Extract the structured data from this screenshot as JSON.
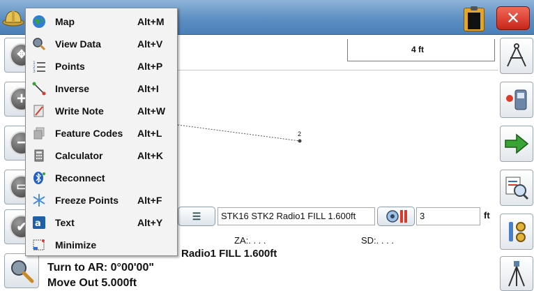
{
  "scale": {
    "label": "4 ft"
  },
  "point": {
    "label": "2"
  },
  "menu": {
    "items": [
      {
        "label": "Map",
        "accel": "Alt+M",
        "icon": "globe-icon"
      },
      {
        "label": "View Data",
        "accel": "Alt+V",
        "icon": "magnifier-icon"
      },
      {
        "label": "Points",
        "accel": "Alt+P",
        "icon": "numbered-list-icon"
      },
      {
        "label": "Inverse",
        "accel": "Alt+I",
        "icon": "line-segment-icon"
      },
      {
        "label": "Write Note",
        "accel": "Alt+W",
        "icon": "notepad-icon"
      },
      {
        "label": "Feature Codes",
        "accel": "Alt+L",
        "icon": "layers-icon"
      },
      {
        "label": "Calculator",
        "accel": "Alt+K",
        "icon": "calculator-icon"
      },
      {
        "label": "Reconnect",
        "accel": "",
        "icon": "bluetooth-icon"
      },
      {
        "label": "Freeze Points",
        "accel": "Alt+F",
        "icon": "snowflake-icon"
      },
      {
        "label": "Text",
        "accel": "Alt+Y",
        "icon": "text-icon"
      },
      {
        "label": "Minimize",
        "accel": "",
        "icon": "minimize-icon"
      }
    ]
  },
  "shot": {
    "description": "STK16 STK2 Radio1 FILL 1.600ft",
    "height": "3",
    "unit": "ft",
    "za_label": "ZA:. . . .",
    "sd_label": "SD:. . . ."
  },
  "stakeout": {
    "description_line": "Radio1 FILL 1.600ft",
    "turn_line": "Turn to AR: 0°00'00\"",
    "move_line": "Move Out 5.000ft"
  },
  "colors": {
    "titlebar": "#5d8fc3",
    "close_button": "#d8322a",
    "arrow_green": "#3aa335"
  }
}
